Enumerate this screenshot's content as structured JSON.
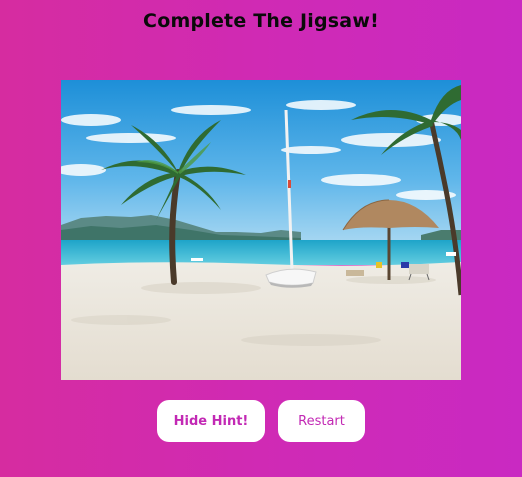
{
  "page": {
    "title": "Complete The Jigsaw!"
  },
  "puzzle": {
    "hint_image": "beach-scene-with-palm-trees-sailboat-and-umbrella"
  },
  "controls": {
    "hide_hint_label": "Hide Hint!",
    "restart_label": "Restart"
  },
  "colors": {
    "background": "#d02bb0",
    "button_text": "#c229b4",
    "button_bg": "#ffffff",
    "title": "#0a0a0a"
  }
}
